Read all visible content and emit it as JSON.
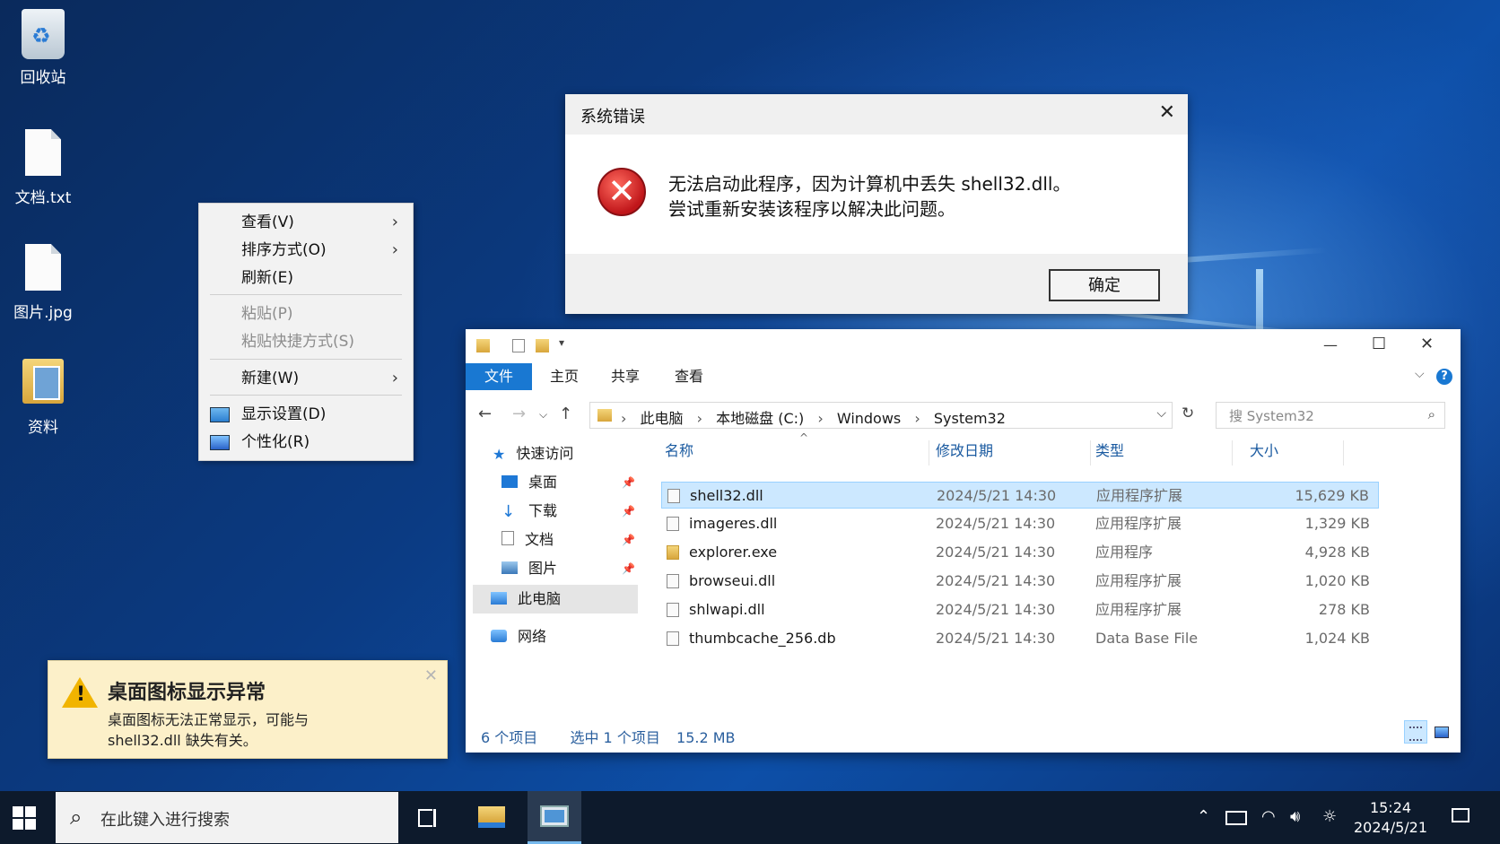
{
  "desktop": {
    "icons": [
      {
        "label": "回收站",
        "icon": "recycle-bin-icon"
      },
      {
        "label": "文档.txt",
        "icon": "text-file-icon"
      },
      {
        "label": "图片.jpg",
        "icon": "image-file-icon"
      },
      {
        "label": "资料",
        "icon": "folder-icon"
      }
    ]
  },
  "context_menu": {
    "items": [
      {
        "label": "查看(V)",
        "submenu": true,
        "enabled": true
      },
      {
        "label": "排序方式(O)",
        "submenu": true,
        "enabled": true
      },
      {
        "label": "刷新(E)",
        "enabled": true
      },
      {
        "label": "粘贴(P)",
        "enabled": false
      },
      {
        "label": "粘贴快捷方式(S)",
        "enabled": false
      },
      {
        "label": "新建(W)",
        "submenu": true,
        "enabled": true
      },
      {
        "label": "显示设置(D)",
        "icon": "display-settings-icon",
        "enabled": true
      },
      {
        "label": "个性化(R)",
        "icon": "personalize-icon",
        "enabled": true
      }
    ]
  },
  "error_dialog": {
    "title": "系统错误",
    "close": "✕",
    "icon": "error-icon",
    "message_line1": "无法启动此程序，因为计算机中丢失 shell32.dll。",
    "message_line2": "尝试重新安装该程序以解决此问题。",
    "ok_label": "确定"
  },
  "explorer": {
    "window_controls": {
      "minimize": "—",
      "maximize": "☐",
      "close": "✕"
    },
    "ribbon_tabs": [
      "文件",
      "主页",
      "共享",
      "查看"
    ],
    "help": "?",
    "breadcrumbs": [
      "此电脑",
      "本地磁盘 (C:)",
      "Windows",
      "System32"
    ],
    "search_placeholder": "搜 System32",
    "nav_tree": [
      {
        "label": "快速访问",
        "icon": "star-icon"
      },
      {
        "label": "桌面",
        "icon": "desktop-icon",
        "pinned": true
      },
      {
        "label": "下载",
        "icon": "download-icon",
        "pinned": true
      },
      {
        "label": "文档",
        "icon": "document-icon",
        "pinned": true
      },
      {
        "label": "图片",
        "icon": "picture-icon",
        "pinned": true
      },
      {
        "label": "此电脑",
        "icon": "this-pc-icon",
        "selected": true
      },
      {
        "label": "网络",
        "icon": "network-icon"
      }
    ],
    "columns": [
      "名称",
      "修改日期",
      "类型",
      "大小"
    ],
    "files": [
      {
        "name": "shell32.dll",
        "date": "2024/5/21 14:30",
        "type": "应用程序扩展",
        "size": "15,629 KB",
        "selected": true
      },
      {
        "name": "imageres.dll",
        "date": "2024/5/21 14:30",
        "type": "应用程序扩展",
        "size": "1,329 KB"
      },
      {
        "name": "explorer.exe",
        "date": "2024/5/21 14:30",
        "type": "应用程序",
        "size": "4,928 KB"
      },
      {
        "name": "browseui.dll",
        "date": "2024/5/21 14:30",
        "type": "应用程序扩展",
        "size": "1,020 KB"
      },
      {
        "name": "shlwapi.dll",
        "date": "2024/5/21 14:30",
        "type": "应用程序扩展",
        "size": "278 KB"
      },
      {
        "name": "thumbcache_256.db",
        "date": "2024/5/21 14:30",
        "type": "Data Base File",
        "size": "1,024 KB"
      }
    ],
    "status_count": "6 个项目",
    "status_selected": "选中 1 个项目",
    "status_size": "15.2 MB"
  },
  "toast": {
    "icon": "warning-icon",
    "title": "桌面图标显示异常",
    "body_line1": "桌面图标无法正常显示，可能与",
    "body_line2": "shell32.dll 缺失有关。",
    "close": "✕"
  },
  "taskbar": {
    "search_placeholder": "在此键入进行搜索",
    "time": "15:24",
    "date": "2024/5/21"
  }
}
